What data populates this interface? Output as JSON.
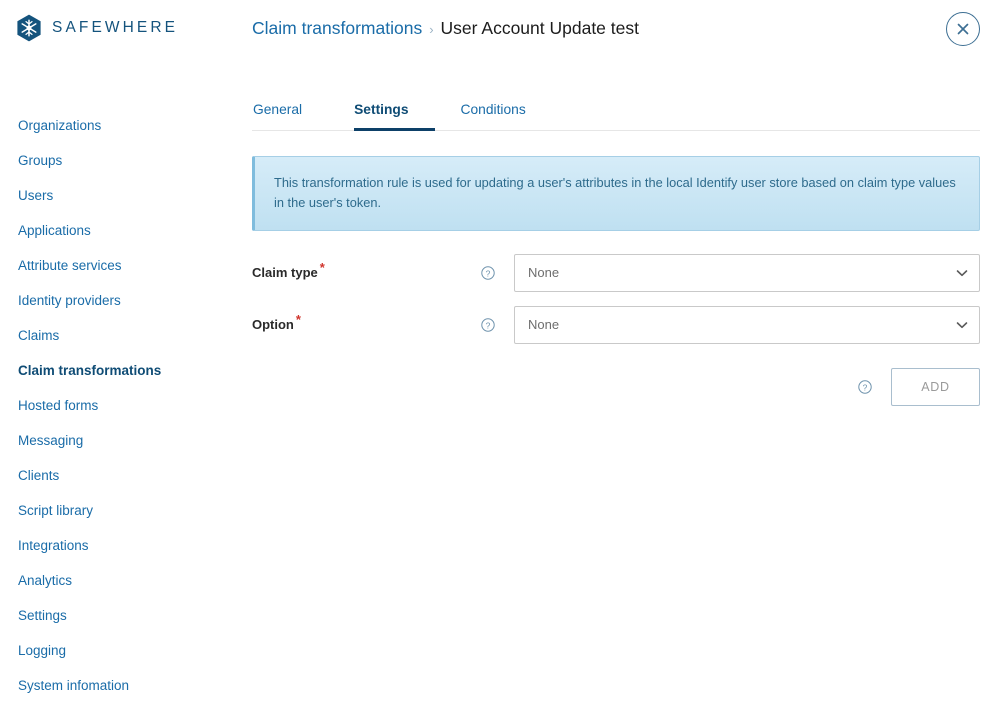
{
  "brand": {
    "name": "SAFEWHERE",
    "logo_icon": "snowflake-hexagon-logo"
  },
  "header": {
    "breadcrumb": {
      "parent": "Claim transformations",
      "separator": "›",
      "current": "User Account Update test"
    },
    "close_icon": "close-icon"
  },
  "sidebar": {
    "items": [
      {
        "label": "Organizations",
        "active": false
      },
      {
        "label": "Groups",
        "active": false
      },
      {
        "label": "Users",
        "active": false
      },
      {
        "label": "Applications",
        "active": false
      },
      {
        "label": "Attribute services",
        "active": false
      },
      {
        "label": "Identity providers",
        "active": false
      },
      {
        "label": "Claims",
        "active": false
      },
      {
        "label": "Claim transformations",
        "active": true
      },
      {
        "label": "Hosted forms",
        "active": false
      },
      {
        "label": "Messaging",
        "active": false
      },
      {
        "label": "Clients",
        "active": false
      },
      {
        "label": "Script library",
        "active": false
      },
      {
        "label": "Integrations",
        "active": false
      },
      {
        "label": "Analytics",
        "active": false
      },
      {
        "label": "Settings",
        "active": false
      },
      {
        "label": "Logging",
        "active": false
      },
      {
        "label": "System infomation",
        "active": false
      }
    ]
  },
  "main": {
    "tabs": [
      {
        "label": "General",
        "active": false
      },
      {
        "label": "Settings",
        "active": true
      },
      {
        "label": "Conditions",
        "active": false
      }
    ],
    "info_banner": {
      "text": "This transformation rule is used for updating a user's attributes in the local Identify user store based on claim type values in the user's token."
    },
    "fields": [
      {
        "label": "Claim type",
        "required_marker": "*",
        "help_icon": "help-circle-icon",
        "value": "None",
        "chevron_icon": "chevron-down-icon"
      },
      {
        "label": "Option",
        "required_marker": "*",
        "help_icon": "help-circle-icon",
        "value": "None",
        "chevron_icon": "chevron-down-icon"
      }
    ],
    "action_row": {
      "help_icon": "help-circle-icon",
      "add_label": "ADD"
    }
  },
  "colors": {
    "brand_blue": "#14537d",
    "link_blue": "#1a6ca8",
    "active_navy": "#0f4c75",
    "banner_bg": "#cfe7f5",
    "banner_text": "#2e6b8c",
    "required_red": "#d0342c",
    "field_border": "#c9c9c9"
  }
}
